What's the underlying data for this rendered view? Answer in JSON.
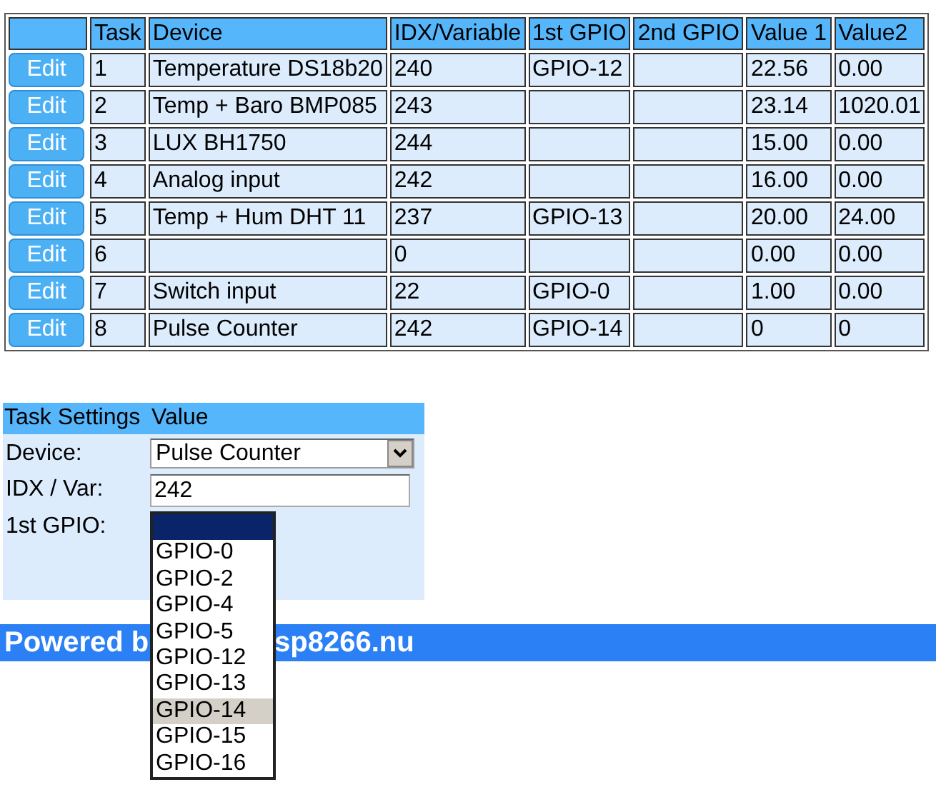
{
  "tasks": {
    "columns": [
      "Task",
      "Device",
      "IDX/Variable",
      "1st GPIO",
      "2nd GPIO",
      "Value 1",
      "Value2"
    ],
    "rows": [
      {
        "button": "Edit",
        "cells": [
          "1",
          "Temperature DS18b20",
          "240",
          "GPIO-12",
          null,
          "22.56",
          "0.00"
        ]
      },
      {
        "button": "Edit",
        "cells": [
          "2",
          "Temp + Baro BMP085",
          "243",
          null,
          null,
          "23.14",
          "1020.01"
        ]
      },
      {
        "button": "Edit",
        "cells": [
          "3",
          "LUX BH1750",
          "244",
          null,
          null,
          "15.00",
          "0.00"
        ]
      },
      {
        "button": "Edit",
        "cells": [
          "4",
          "Analog input",
          "242",
          null,
          null,
          "16.00",
          "0.00"
        ]
      },
      {
        "button": "Edit",
        "cells": [
          "5",
          "Temp + Hum DHT 11",
          "237",
          "GPIO-13",
          null,
          "20.00",
          "24.00"
        ]
      },
      {
        "button": "Edit",
        "cells": [
          "6",
          null,
          "0",
          null,
          null,
          "0.00",
          "0.00"
        ]
      },
      {
        "button": "Edit",
        "cells": [
          "7",
          "Switch input",
          "22",
          "GPIO-0",
          null,
          "1.00",
          "0.00"
        ]
      },
      {
        "button": "Edit",
        "cells": [
          "8",
          "Pulse Counter",
          "242",
          "GPIO-14",
          null,
          "0",
          "0"
        ]
      }
    ]
  },
  "settings": {
    "header": [
      "Task Settings",
      "Value"
    ],
    "fields": [
      {
        "kind": "select",
        "label": "Device:",
        "value": "Pulse Counter"
      },
      {
        "kind": "input",
        "label": "IDX / Var:",
        "value": "242"
      },
      {
        "kind": "open-select",
        "label": "1st GPIO:",
        "options": [
          {
            "kind": "blank",
            "highlighted": true,
            "selected": false
          },
          {
            "kind": "option",
            "label": "GPIO-0",
            "highlighted": false,
            "selected": false
          },
          {
            "kind": "option",
            "label": "GPIO-2",
            "highlighted": false,
            "selected": false
          },
          {
            "kind": "option",
            "label": "GPIO-4",
            "highlighted": false,
            "selected": false
          },
          {
            "kind": "option",
            "label": "GPIO-5",
            "highlighted": false,
            "selected": false
          },
          {
            "kind": "option",
            "label": "GPIO-12",
            "highlighted": false,
            "selected": false
          },
          {
            "kind": "option",
            "label": "GPIO-13",
            "highlighted": false,
            "selected": false
          },
          {
            "kind": "option",
            "label": "GPIO-14",
            "highlighted": false,
            "selected": true
          },
          {
            "kind": "option",
            "label": "GPIO-15",
            "highlighted": false,
            "selected": false
          },
          {
            "kind": "option",
            "label": "GPIO-16",
            "highlighted": false,
            "selected": false
          }
        ]
      }
    ]
  },
  "footer": {
    "text_left": "Powered b",
    "text_right": "sp8266.nu"
  }
}
